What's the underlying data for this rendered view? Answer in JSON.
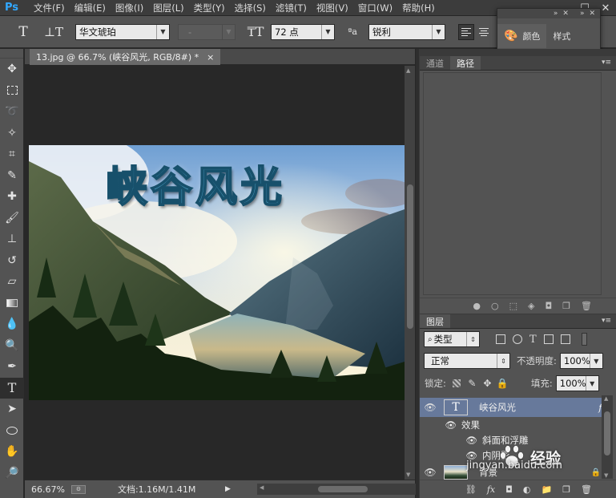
{
  "app": {
    "logo": "Ps"
  },
  "menu": [
    "文件(F)",
    "编辑(E)",
    "图像(I)",
    "图层(L)",
    "类型(Y)",
    "选择(S)",
    "滤镜(T)",
    "视图(V)",
    "窗口(W)",
    "帮助(H)"
  ],
  "options": {
    "font_family": "华文琥珀",
    "font_style": "-",
    "font_size": "72 点",
    "aa_icon": "ªa",
    "antialias": "锐利"
  },
  "float_panel": {
    "color_tab": "颜色",
    "style_tab": "样式"
  },
  "document": {
    "tab_title": "13.jpg @ 66.7% (峡谷风光, RGB/8#) *",
    "close": "×",
    "title_text": "峡谷风光",
    "zoom": "66.67%",
    "doc_size": "文档:1.16M/1.41M"
  },
  "paths_panel": {
    "tabs": [
      "通道",
      "路径"
    ],
    "active_tab": 1
  },
  "layers_panel": {
    "tab": "图层",
    "filter_kind": "类型",
    "blend_mode": "正常",
    "opacity_label": "不透明度:",
    "opacity_value": "100%",
    "lock_label": "锁定:",
    "fill_label": "填充:",
    "fill_value": "100%",
    "layers": [
      {
        "name": "峡谷风光",
        "type": "text",
        "fx": "fx"
      },
      {
        "name": "效果"
      },
      {
        "name": "斜面和浮雕"
      },
      {
        "name": "内阴影"
      },
      {
        "name": "背景"
      }
    ]
  },
  "watermark": {
    "name": "经验",
    "url": "jingyan.baidu.com"
  },
  "colors": {
    "accent": "#31a8ff",
    "selection": "#67799b",
    "panel": "#535353"
  }
}
